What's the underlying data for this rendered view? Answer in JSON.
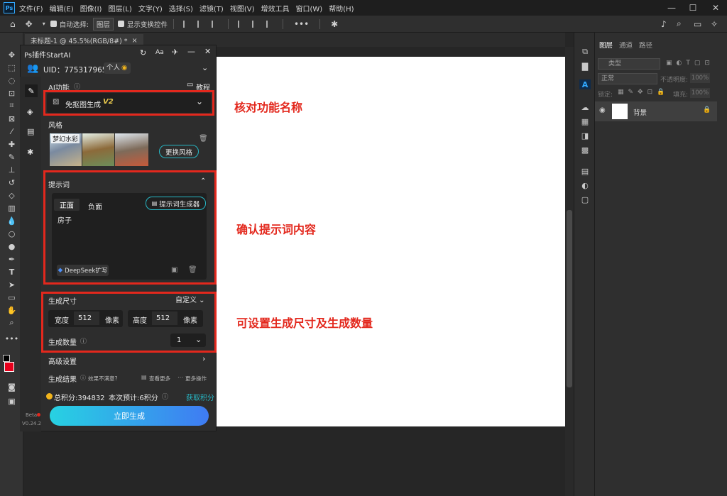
{
  "app": {
    "logo": "Ps"
  },
  "menu": [
    "文件(F)",
    "编辑(E)",
    "图像(I)",
    "图层(L)",
    "文字(Y)",
    "选择(S)",
    "滤镜(T)",
    "视图(V)",
    "增效工具",
    "窗口(W)",
    "帮助(H)"
  ],
  "window_controls": {
    "minimize": "—",
    "maximize": "☐",
    "close": "✕"
  },
  "options": {
    "auto_select_label": "自动选择:",
    "auto_select_value": "图层",
    "transform_label": "显示变换控件"
  },
  "document_tab": {
    "title": "未标题-1 @ 45.5%(RGB/8#) *",
    "close": "×"
  },
  "layers_panel": {
    "tabs": [
      "图层",
      "通道",
      "路径"
    ],
    "search_placeholder": "类型",
    "blend_mode": "正常",
    "opacity_label": "不透明度:",
    "opacity_value": "100%",
    "lock_label": "锁定:",
    "fill_label": "填充:",
    "fill_value": "100%",
    "layers": [
      {
        "name": "背景",
        "locked": true
      }
    ]
  },
  "plugin": {
    "title": "Ps插件StartAI",
    "uid_label": "UID：775317965",
    "account_type": "个人",
    "ai_function_label": "AI功能",
    "tutorial_label": "教程",
    "function_selected": "免抠图生成",
    "function_version": "V2",
    "style_label": "风格",
    "style_name": "梦幻水彩",
    "change_style_button": "更换风格",
    "prompt_section_label": "提示词",
    "prompt_tabs": [
      "正面",
      "负面"
    ],
    "prompt_generator_button": "提示词生成器",
    "prompt_text": "房子",
    "deepseek_button": "DeepSeek扩写",
    "size_label": "生成尺寸",
    "size_mode": "自定义",
    "width_label": "宽度",
    "width_value": "512",
    "width_unit": "像素",
    "height_label": "高度",
    "height_value": "512",
    "height_unit": "像素",
    "count_label": "生成数量",
    "count_value": "1",
    "advanced_label": "高级设置",
    "result_label": "生成结果",
    "result_unsatisfied": "效果不满意?",
    "view_more": "查看更多",
    "more_actions": "更多操作",
    "points_total": "总积分:394832",
    "points_estimate": "本次预计:6积分",
    "get_points": "获取积分",
    "generate_button": "立即生成",
    "beta_label": "Beta",
    "version_label": "V0.24.2"
  },
  "annotations": [
    "核对功能名称",
    "确认提示词内容",
    "可设置生成尺寸及生成数量"
  ],
  "colors": {
    "annotation_red": "#e3281d",
    "accent_cyan": "#27b8c6",
    "gradient_start": "#27d2e2",
    "gradient_end": "#3f7bf3",
    "points_gold": "#f2b51c",
    "foreground_swatch": "#e8001c"
  }
}
